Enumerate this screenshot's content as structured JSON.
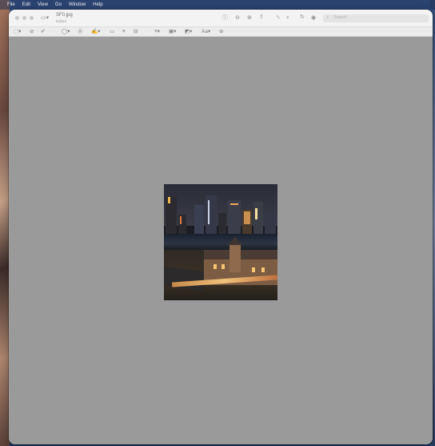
{
  "menubar": {
    "items": [
      "File",
      "Edit",
      "View",
      "Go",
      "Window",
      "Help"
    ]
  },
  "window": {
    "filename": "SF0.jpg",
    "subtitle": "Edited",
    "search_placeholder": "Search"
  },
  "icons": {
    "sidebar": "sidebar-toggle-icon",
    "info": "info-icon",
    "zoom_out": "zoom-out-icon",
    "zoom_in": "zoom-in-icon",
    "share": "share-icon",
    "markup": "markup-pen-icon",
    "rotate": "rotate-icon",
    "annotate": "annotate-icon"
  },
  "colors": {
    "canvas": "#9a9a9a",
    "titlebar": "#f3f3f3",
    "toolbar": "#ececec"
  }
}
